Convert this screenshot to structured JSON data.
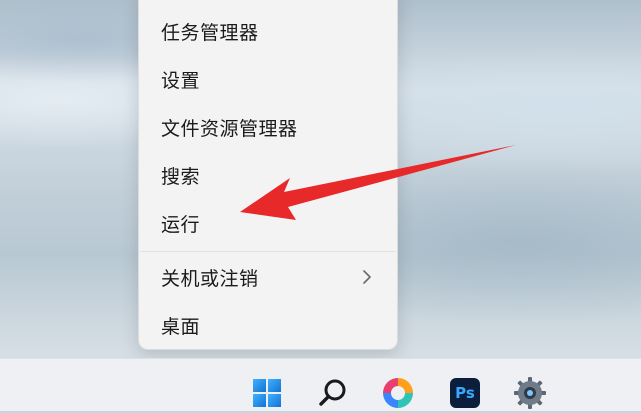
{
  "context_menu": {
    "items": [
      {
        "label": "任务管理器"
      },
      {
        "label": "设置"
      },
      {
        "label": "文件资源管理器"
      },
      {
        "label": "搜索"
      },
      {
        "label": "运行"
      },
      {
        "label": "关机或注销",
        "has_submenu": true
      },
      {
        "label": "桌面"
      }
    ]
  },
  "annotation": {
    "arrow_color": "#e8292a",
    "points_to": "运行"
  },
  "taskbar": {
    "icons": [
      "windows-start-icon",
      "search-icon",
      "color-wheel-app-icon",
      "photoshop-icon",
      "gear-icon"
    ],
    "photoshop_text": "Ps"
  },
  "colors": {
    "menu_bg": "#f3f3f3",
    "taskbar_bg": "#eef0f3",
    "start_blue": "#1e90ff"
  }
}
